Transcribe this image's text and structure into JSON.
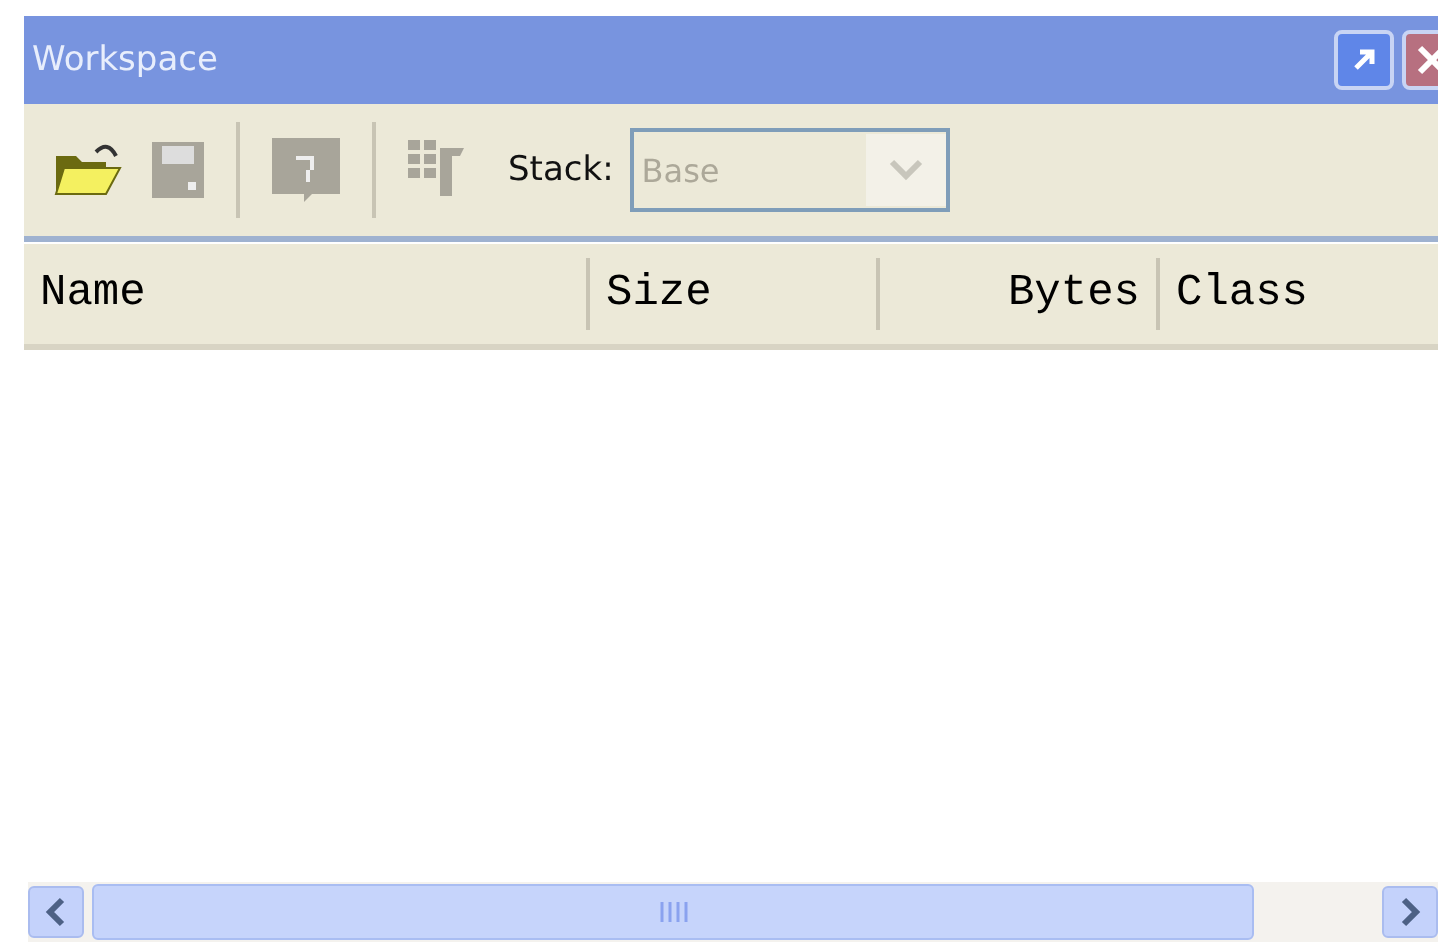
{
  "window": {
    "title": "Workspace"
  },
  "toolbar": {
    "buttons": [
      {
        "kind": "open",
        "disabled": false
      },
      {
        "kind": "save",
        "disabled": true
      },
      {
        "kind": "separator"
      },
      {
        "kind": "edit",
        "disabled": true
      },
      {
        "kind": "separator"
      },
      {
        "kind": "grid",
        "disabled": true
      }
    ],
    "stack": {
      "label": "Stack:",
      "value": "Base",
      "disabled": true
    }
  },
  "table": {
    "columns": [
      {
        "label": "Name",
        "kind": "text"
      },
      {
        "label": "Size",
        "kind": "text"
      },
      {
        "label": "Bytes",
        "kind": "numeric"
      },
      {
        "label": "Class",
        "kind": "text"
      }
    ]
  }
}
